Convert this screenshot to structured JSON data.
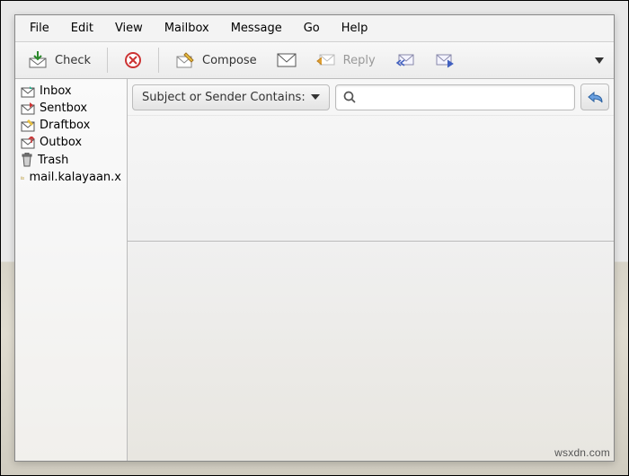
{
  "menubar": [
    "File",
    "Edit",
    "View",
    "Mailbox",
    "Message",
    "Go",
    "Help"
  ],
  "toolbar": {
    "check": "Check",
    "compose": "Compose",
    "reply": "Reply"
  },
  "sidebar": {
    "items": [
      {
        "icon": "inbox-icon",
        "label": "Inbox"
      },
      {
        "icon": "sentbox-icon",
        "label": "Sentbox"
      },
      {
        "icon": "draftbox-icon",
        "label": "Draftbox"
      },
      {
        "icon": "outbox-icon",
        "label": "Outbox"
      },
      {
        "icon": "trash-icon",
        "label": "Trash"
      },
      {
        "icon": "folder-icon",
        "label": "mail.kalayaan.x"
      }
    ]
  },
  "filter": {
    "label": "Subject or Sender Contains:",
    "placeholder": ""
  },
  "watermark": "wsxdn.com"
}
